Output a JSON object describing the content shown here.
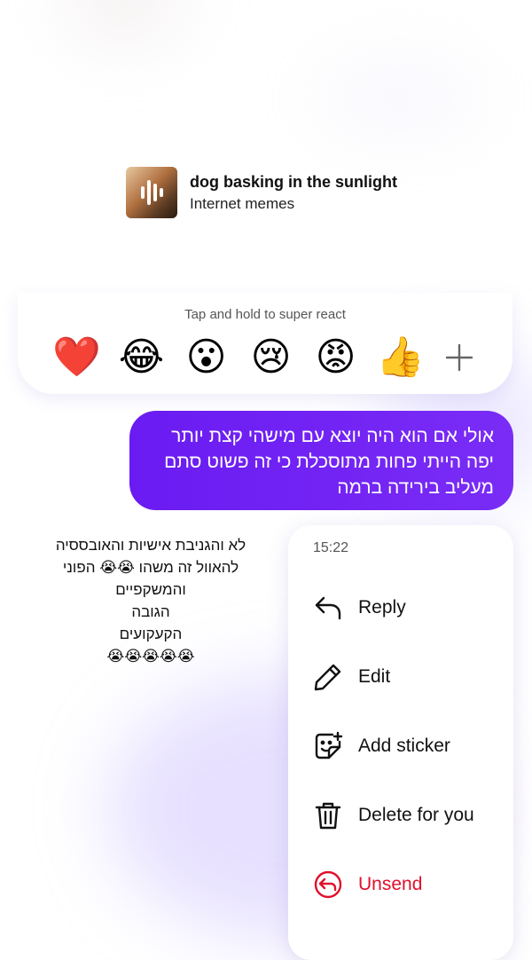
{
  "shared_post": {
    "title": "dog basking in the sunlight",
    "subtitle": "Internet memes"
  },
  "reactions": {
    "hint": "Tap and hold to super react",
    "emojis": [
      "❤️",
      "😂",
      "😮",
      "😢",
      "😡",
      "👍"
    ],
    "more_icon": "plus-icon"
  },
  "sent_message": {
    "lines": [
      "אולי אם הוא היה יוצא עם מישהי קצת יותר",
      "יפה הייתי פחות מתוסכלת כי זה פשוט סתם",
      "מעליב בירידה ברמה"
    ]
  },
  "received_message": {
    "lines": [
      "לא והגניבת אישיות והאובססיה",
      "להאוול זה משהו 😭😭 הפוני",
      "והמשקפיים",
      "הגובה",
      "הקעקועים",
      "😭😭😭😭😭"
    ]
  },
  "context_menu": {
    "time": "15:22",
    "items": [
      {
        "label": "Reply",
        "icon": "reply-icon"
      },
      {
        "label": "Edit",
        "icon": "pencil-icon"
      },
      {
        "label": "Add sticker",
        "icon": "sticker-icon"
      },
      {
        "label": "Delete for you",
        "icon": "trash-icon"
      },
      {
        "label": "Unsend",
        "icon": "unsend-icon"
      }
    ],
    "danger_color": "#e0102a"
  },
  "colors": {
    "bubble": "#6a1bf2",
    "background": "#ffffff"
  }
}
